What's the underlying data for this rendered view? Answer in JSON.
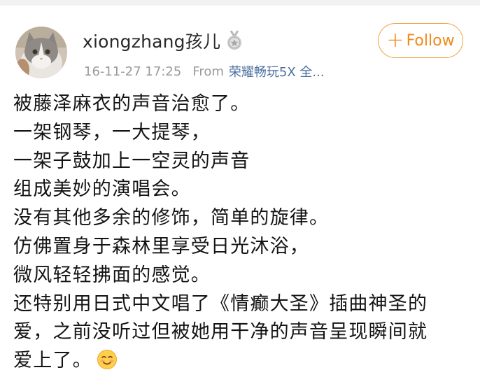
{
  "post": {
    "username": "xiongzhang孩儿",
    "timestamp": "16-11-27 17:25",
    "from_label": "From",
    "device": "荣耀畅玩5X 全...",
    "follow_label": "Follow",
    "lines": [
      "被藤泽麻衣的声音治愈了。",
      "一架钢琴，一大提琴，",
      "一架子鼓加上一空灵的声音",
      "组成美妙的演唱会。",
      "没有其他多余的修饰，简单的旋律。",
      "仿佛置身于森林里享受日光沐浴，",
      "微风轻轻拂面的感觉。",
      "还特别用日式中文唱了《情癫大圣》插曲神圣的",
      "爱，之前没听过但被她用干净的声音呈现瞬间就",
      "爱上了。"
    ]
  },
  "icons": {
    "avatar": "cat-avatar",
    "badge": "medal-icon",
    "emoji": "smiling-face-emoji-icon",
    "plus": "plus-icon"
  },
  "colors": {
    "follow_accent": "#f08a1c",
    "follow_border": "#f0a040",
    "meta_gray": "#9a9a9a",
    "device_link": "#4a6f9f",
    "text": "#141414"
  }
}
